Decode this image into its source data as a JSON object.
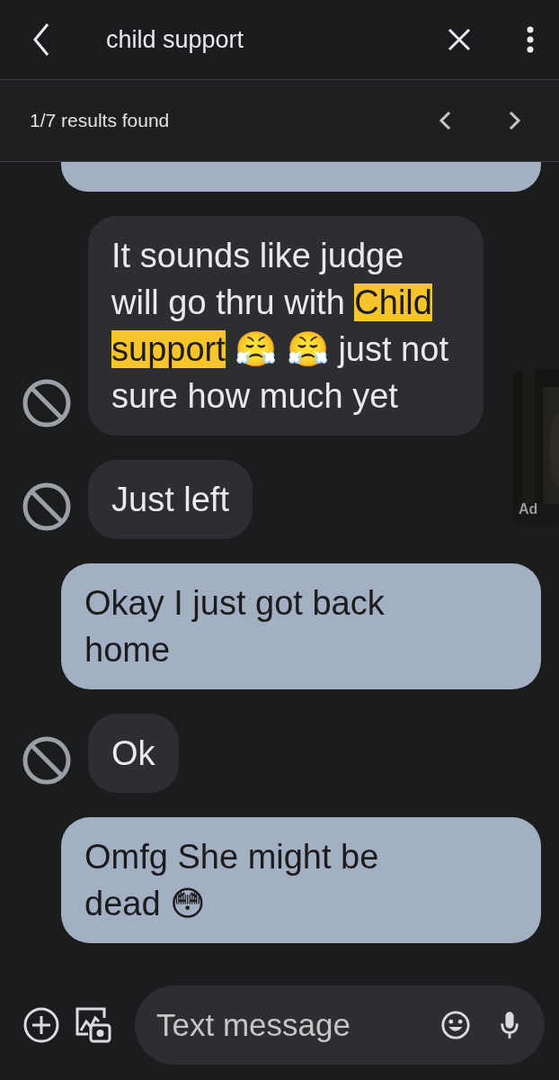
{
  "search": {
    "query": "child support",
    "results": "1/7 results found"
  },
  "messages": [
    {
      "kind": "outgoing"
    },
    {
      "kind": "incoming",
      "parts": [
        {
          "text": "It sounds like judge will go thru with ",
          "highlight": false
        },
        {
          "text": "Child",
          "highlight": true
        },
        {
          "text": "support",
          "highlight": true
        },
        {
          "text": " 😤 😤 just not sure how much yet",
          "highlight": false
        }
      ]
    },
    {
      "kind": "incoming",
      "parts": [
        {
          "text": "Just left",
          "highlight": false
        }
      ]
    },
    {
      "kind": "outgoing",
      "parts": [
        {
          "text": "Okay I just got back home",
          "highlight": false
        }
      ]
    },
    {
      "kind": "incoming",
      "parts": [
        {
          "text": "Ok",
          "highlight": false
        }
      ]
    },
    {
      "kind": "outgoing",
      "parts": [
        {
          "text": "Omfg She might be dead 😳",
          "highlight": false
        }
      ]
    }
  ],
  "ad": {
    "label": "Ad"
  },
  "composer": {
    "placeholder": "Text message"
  }
}
